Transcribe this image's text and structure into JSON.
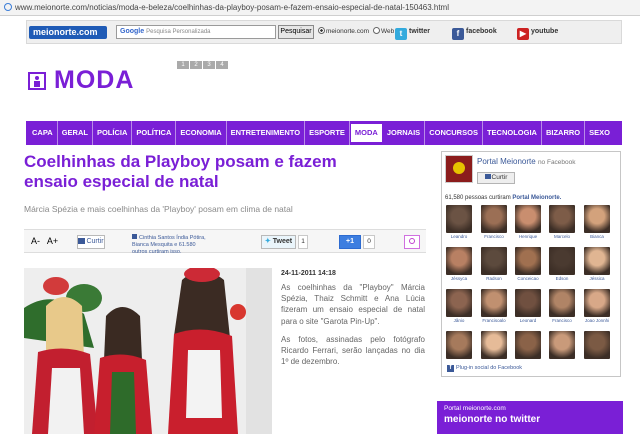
{
  "browser": {
    "url": "www.meionorte.com/noticias/moda-e-beleza/coelhinhas-da-playboy-posam-e-fazem-ensaio-especial-de-natal-150463.html"
  },
  "topbar": {
    "logo": "meionorte.com",
    "search_google": "Google",
    "search_placeholder": "Pesquisa Personalizada",
    "search_button": "Pesquisar",
    "radio_site": "meionorte.com",
    "radio_web": "Web",
    "twitter": "twitter",
    "facebook": "facebook",
    "youtube": "youtube"
  },
  "section": {
    "title": "MODA",
    "pages": [
      "1",
      "2",
      "3",
      "4"
    ]
  },
  "nav": {
    "items": [
      "CAPA",
      "GERAL",
      "POLÍCIA",
      "POLÍTICA",
      "ECONOMIA",
      "ENTRETENIMENTO",
      "ESPORTE",
      "MODA",
      "JORNAIS",
      "CONCURSOS",
      "TECNOLOGIA",
      "BIZARRO",
      "SEXO"
    ],
    "active": "MODA"
  },
  "article": {
    "title": "Coelhinhas da Playboy posam e fazem ensaio especial de natal",
    "subtitle": "Márcia Spézia e mais coelhinhas da 'Playboy' posam em clima de natal",
    "font_minus": "A-",
    "font_plus": "A+",
    "fb_like": "Curtir",
    "fb_likers": "Cinthia Santos Índia Pótira, Bianca Mesquita e 61.580 outros curtiram isso.",
    "tweet": "Tweet",
    "tweet_count": "1",
    "plusone": "+1",
    "plusone_count": "0",
    "date": "24-11-2011 14:18",
    "paragraphs": [
      "As coelhinhas da \"Playboy\" Márcia Spézia, Thaiz Schmitt e Ana Lúcia fizeram um ensaio especial de natal para o site \"Garota Pin-Up\".",
      "As fotos, assinadas pelo fotógrafo Ricardo Ferrari, serão lançadas no dia 1º de dezembro."
    ]
  },
  "fbbox": {
    "title": "Portal Meionorte",
    "title_suffix": "no Facebook",
    "like": "Curtir",
    "count_text": "61,580 pessoas curtiram",
    "count_page": "Portal Meionorte.",
    "fans": [
      "Leandro",
      "Francisco",
      "Henrique",
      "Marcelo",
      "Bianca",
      "Jéssyca",
      "Radson",
      "Conceicao",
      "Edson",
      "Jéssica",
      "Jânio",
      "Francisoalo",
      "Leonard",
      "Francisco",
      "Joao Jonnhi",
      "",
      "",
      "",
      "",
      ""
    ],
    "plugin": "Plug-in social do Facebook"
  },
  "twitterbox": {
    "small": "Portal meionorte.com",
    "big": "meionorte no twitter"
  },
  "colors": {
    "accent": "#7a1fd6",
    "facebook": "#3b5998"
  }
}
